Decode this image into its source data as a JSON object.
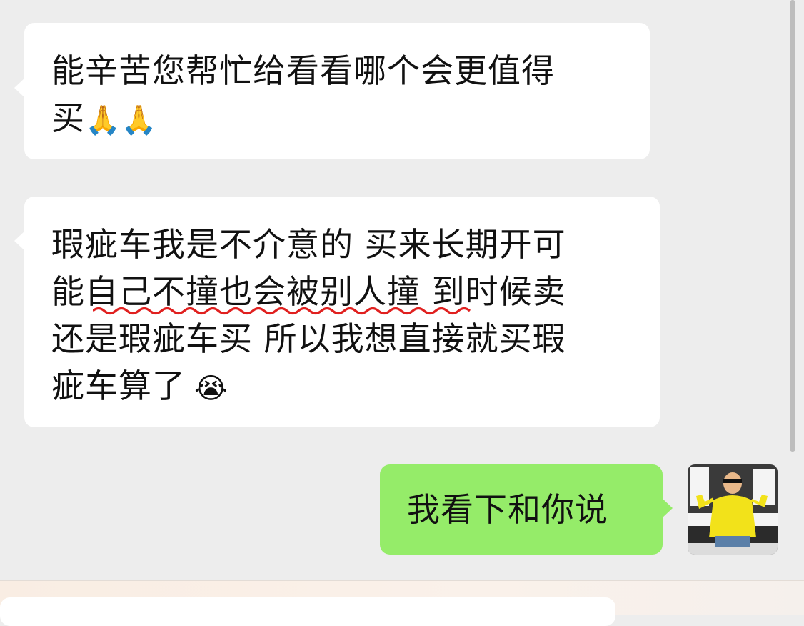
{
  "messages": [
    {
      "direction": "incoming",
      "lines": [
        "能辛苦您帮忙给看看哪个会更值得",
        "买"
      ],
      "emojis": [
        "🙏",
        "🙏"
      ],
      "emoji_names": [
        "folded-hands-icon",
        "folded-hands-icon"
      ]
    },
    {
      "direction": "incoming",
      "lines": [
        "瑕疵车我是不介意的 买来长期开可",
        "能",
        "自己不撞也会被别人撞",
        " 到时候卖",
        "还是瑕疵车买 所以我想直接就买瑕",
        "疵车算了"
      ],
      "emojis": [
        "😭"
      ],
      "emoji_names": [
        "face-with-tears-emoji"
      ],
      "spellcheck_underlined": "自己不撞也会被别人撞"
    },
    {
      "direction": "outgoing",
      "lines": [
        "我看下和你说"
      ]
    }
  ],
  "colors": {
    "background": "#ededed",
    "incoming_bubble": "#ffffff",
    "outgoing_bubble": "#95ec69",
    "spellcheck": "#e0201f",
    "avatar_shirt": "#f2e21a"
  }
}
